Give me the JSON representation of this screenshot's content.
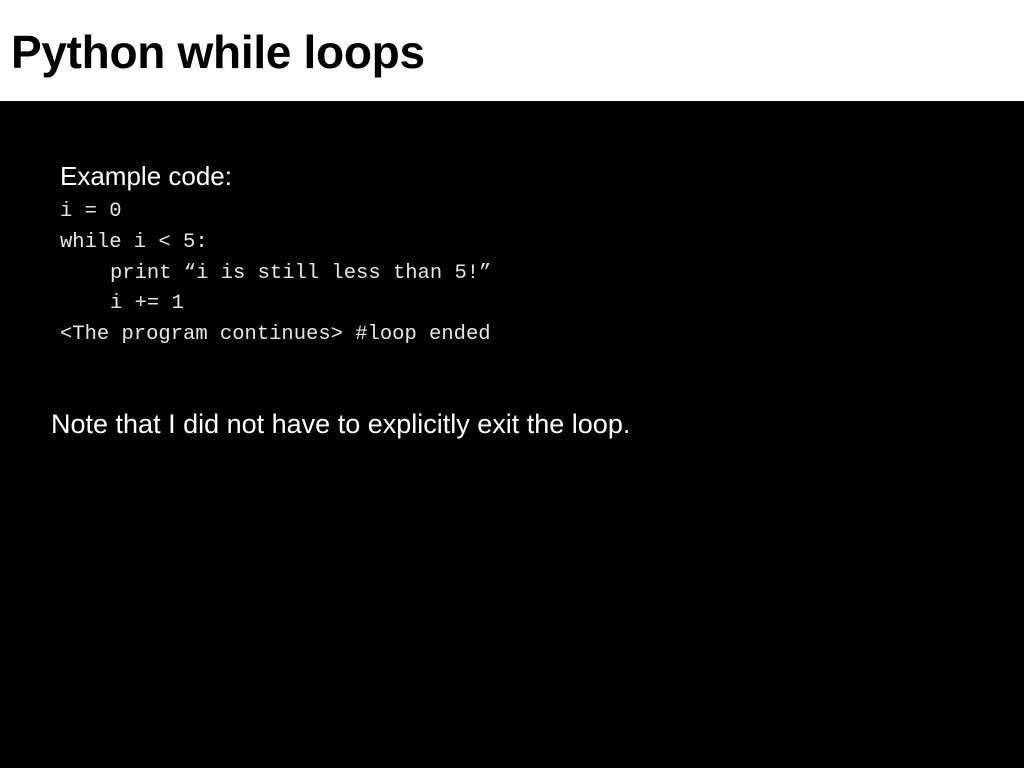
{
  "slide": {
    "title": "Python while loops",
    "example_label": "Example code:",
    "code_lines": [
      {
        "indent": 0,
        "text": "i = 0"
      },
      {
        "indent": 0,
        "text": "while i < 5:"
      },
      {
        "indent": 1,
        "text": "print “i is still less than 5!”"
      },
      {
        "indent": 1,
        "text": "i += 1"
      },
      {
        "indent": 0,
        "text": "<The program continues> #loop ended"
      }
    ],
    "note": "Note that I did not have to explicitly exit the loop."
  }
}
